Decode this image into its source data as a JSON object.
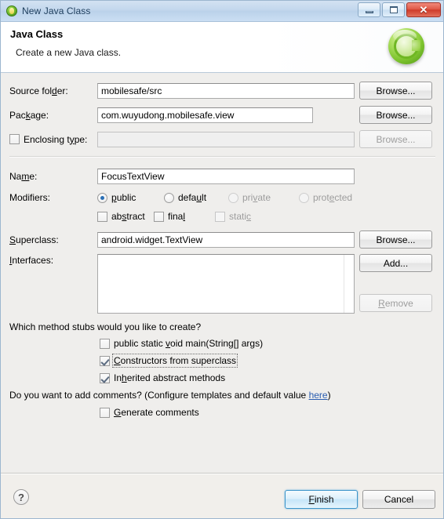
{
  "window": {
    "title": "New Java Class",
    "icon": "java-class-icon",
    "controls": {
      "minimize": "minimize-icon",
      "maximize": "maximize-icon",
      "close": "✕"
    }
  },
  "banner": {
    "title": "Java Class",
    "subtitle": "Create a new Java class.",
    "icon": "new-class-wizard-icon"
  },
  "form": {
    "source_folder": {
      "label_pre": "Source fol",
      "label_mn": "d",
      "label_post": "er:",
      "value": "mobilesafe/src",
      "browse": "Browse..."
    },
    "package": {
      "label_pre": "Pac",
      "label_mn": "k",
      "label_post": "age:",
      "value": "com.wuyudong.mobilesafe.view",
      "browse": "Browse..."
    },
    "enclosing_type": {
      "label_pre": "Enclosing t",
      "label_mn": "y",
      "label_post": "pe:",
      "value": "",
      "checked": false,
      "browse": "Browse..."
    },
    "name": {
      "label_pre": "Na",
      "label_mn": "m",
      "label_post": "e:",
      "value": "FocusTextView"
    },
    "modifiers": {
      "label": "Modifiers:",
      "radios": [
        {
          "pre": "",
          "mn": "p",
          "post": "ublic",
          "selected": true,
          "enabled": true
        },
        {
          "pre": "defa",
          "mn": "u",
          "post": "lt",
          "selected": false,
          "enabled": true
        },
        {
          "pre": "pri",
          "mn": "v",
          "post": "ate",
          "selected": false,
          "enabled": false
        },
        {
          "pre": "prot",
          "mn": "e",
          "post": "cted",
          "selected": false,
          "enabled": false
        }
      ],
      "checks": [
        {
          "pre": "ab",
          "mn": "s",
          "post": "tract",
          "checked": false,
          "enabled": true
        },
        {
          "pre": "fina",
          "mn": "l",
          "post": "",
          "checked": false,
          "enabled": true
        },
        {
          "pre": "stati",
          "mn": "c",
          "post": "",
          "checked": false,
          "enabled": false
        }
      ]
    },
    "superclass": {
      "label_pre": "",
      "label_mn": "S",
      "label_post": "uperclass:",
      "value": "android.widget.TextView",
      "browse": "Browse..."
    },
    "interfaces": {
      "label_pre": "",
      "label_mn": "I",
      "label_post": "nterfaces:",
      "items": [],
      "add": "Add...",
      "remove_pre": "",
      "remove_mn": "R",
      "remove_post": "emove"
    }
  },
  "stubs": {
    "question": "Which method stubs would you like to create?",
    "items": [
      {
        "pre": "public static ",
        "mn": "v",
        "post": "oid main(String[] args)",
        "checked": false,
        "focused": false
      },
      {
        "pre": "",
        "mn": "C",
        "post": "onstructors from superclass",
        "checked": true,
        "focused": true
      },
      {
        "pre": "In",
        "mn": "h",
        "post": "erited abstract methods",
        "checked": true,
        "focused": false
      }
    ]
  },
  "comments": {
    "question_pre": "Do you want to add comments? (Configure templates and default value ",
    "link": "here",
    "question_post": ")",
    "checkbox": {
      "pre": "",
      "mn": "G",
      "post": "enerate comments",
      "checked": false
    }
  },
  "footer": {
    "help": "?",
    "finish_pre": "",
    "finish_mn": "F",
    "finish_post": "inish",
    "cancel": "Cancel"
  }
}
